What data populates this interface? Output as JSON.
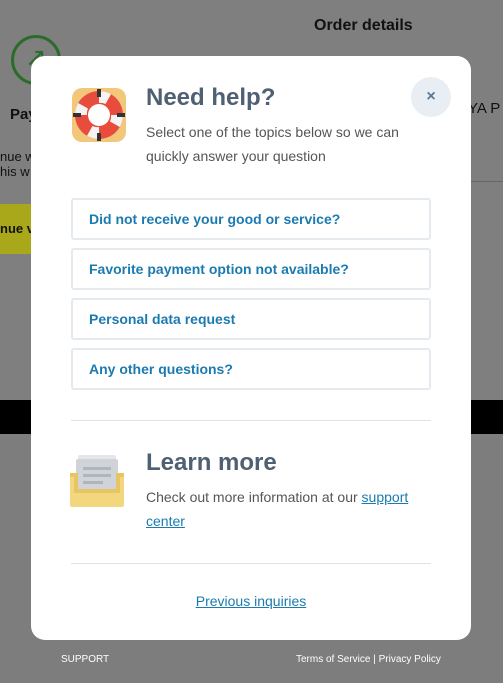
{
  "background": {
    "order_title": "Order details",
    "pay_label": "Pay",
    "continue_text_line1": "nue w",
    "continue_text_line2": "his w",
    "continue_button_label": "nue v",
    "ya_text": "YA P",
    "footer_support": "SUPPORT",
    "footer_links": "Terms of Service | Privacy Policy"
  },
  "modal": {
    "close_label": "×",
    "help": {
      "title": "Need help?",
      "description": "Select one of the topics below so we can quickly answer your question",
      "icon": "lifebuoy-icon"
    },
    "topics": [
      {
        "label": "Did not receive your good or service?"
      },
      {
        "label": "Favorite payment option not available?"
      },
      {
        "label": "Personal data request"
      },
      {
        "label": "Any other questions?"
      }
    ],
    "learn": {
      "title": "Learn more",
      "description_prefix": "Check out more information at our ",
      "link_text": "support center",
      "icon": "inbox-tray-icon"
    },
    "previous_inquiries_label": "Previous inquiries"
  },
  "colors": {
    "accent": "#1b7bb0",
    "heading": "#4f6072",
    "overlay": "#7f7f7f"
  }
}
